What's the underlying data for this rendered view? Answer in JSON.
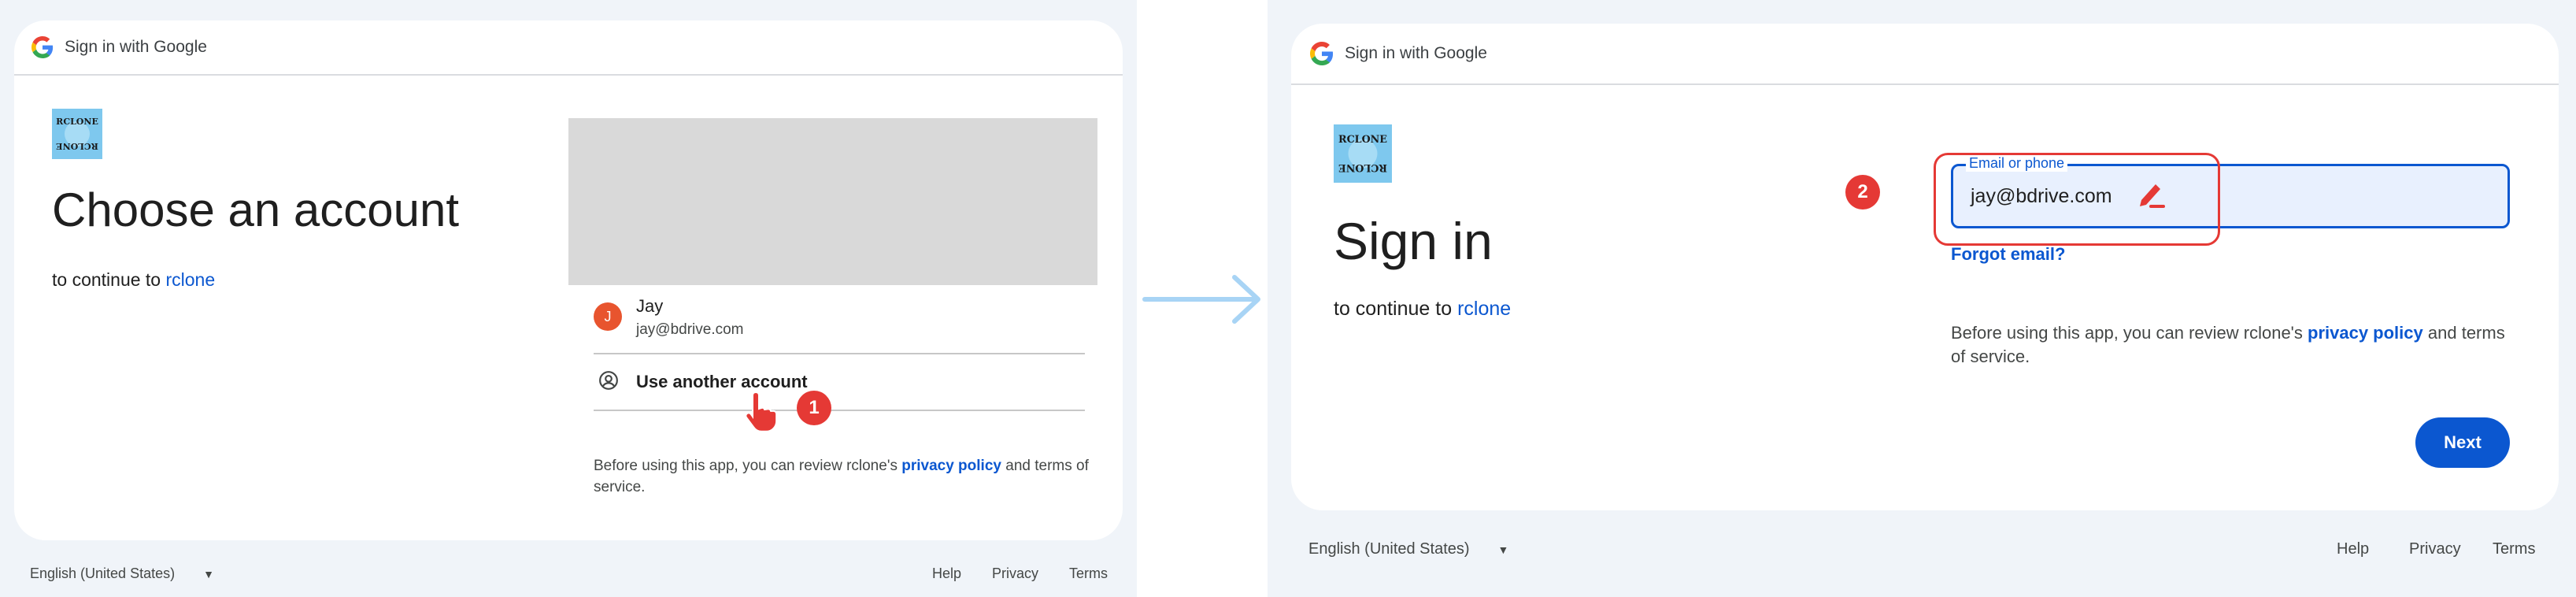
{
  "left": {
    "header_title": "Sign in with Google",
    "app_logo_text": "RCLONE",
    "heading": "Choose an account",
    "subline_prefix": "to continue to",
    "app_name": "rclone",
    "account": {
      "avatar_initial": "J",
      "name": "Jay",
      "email": "jay@bdrive.com"
    },
    "use_another": "Use another account",
    "disclaimer_prefix": "Before using this app, you can review rclone's",
    "privacy_policy": "privacy policy",
    "disclaimer_suffix": "and terms of service.",
    "step_badge": "1",
    "footer": {
      "language": "English (United States)",
      "help": "Help",
      "privacy": "Privacy",
      "terms": "Terms"
    }
  },
  "right": {
    "header_title": "Sign in with Google",
    "app_logo_text": "RCLONE",
    "heading": "Sign in",
    "subline_prefix": "to continue to",
    "app_name": "rclone",
    "email_field": {
      "label": "Email or phone",
      "value": "jay@bdrive.com"
    },
    "forgot_email": "Forgot email?",
    "disclaimer_prefix": "Before using this app, you can review rclone's",
    "privacy_policy": "privacy policy",
    "disclaimer_suffix": "and terms of service.",
    "next_button": "Next",
    "step_badge": "2",
    "footer": {
      "language": "English (United States)",
      "help": "Help",
      "privacy": "Privacy",
      "terms": "Terms"
    }
  },
  "colors": {
    "accent": "#0b57d0",
    "badge": "#e53935",
    "avatar": "#e8542e",
    "background": "#f0f4f9"
  }
}
